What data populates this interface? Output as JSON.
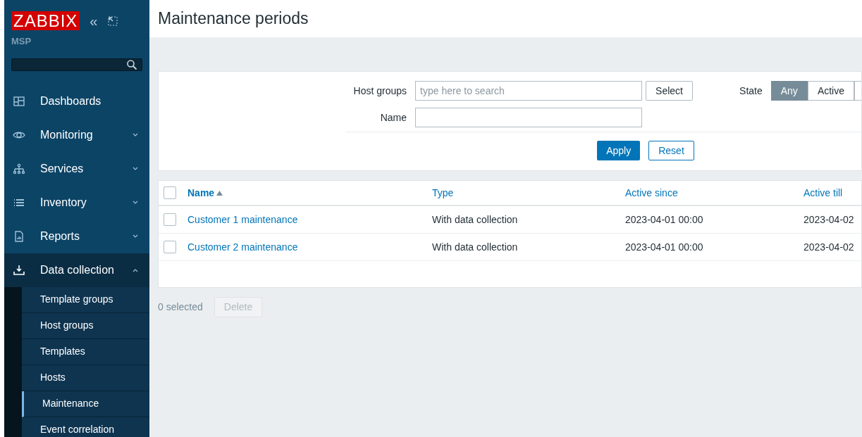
{
  "sidebar": {
    "logo": "ZABBIX",
    "collapse_glyph": "«",
    "server_name": "MSP",
    "menu": [
      {
        "label": "Dashboards",
        "kind": "dashboard",
        "expandable": false,
        "expanded": false
      },
      {
        "label": "Monitoring",
        "kind": "eye",
        "expandable": true,
        "expanded": false
      },
      {
        "label": "Services",
        "kind": "tree",
        "expandable": true,
        "expanded": false
      },
      {
        "label": "Inventory",
        "kind": "list",
        "expandable": true,
        "expanded": false
      },
      {
        "label": "Reports",
        "kind": "report",
        "expandable": true,
        "expanded": false
      },
      {
        "label": "Data collection",
        "kind": "download",
        "expandable": true,
        "expanded": true,
        "children": [
          {
            "label": "Template groups",
            "selected": false
          },
          {
            "label": "Host groups",
            "selected": false
          },
          {
            "label": "Templates",
            "selected": false
          },
          {
            "label": "Hosts",
            "selected": false
          },
          {
            "label": "Maintenance",
            "selected": true
          },
          {
            "label": "Event correlation",
            "selected": false
          }
        ]
      }
    ]
  },
  "page": {
    "title": "Maintenance periods"
  },
  "filter": {
    "host_groups_label": "Host groups",
    "host_groups_placeholder": "type here to search",
    "select_button": "Select",
    "name_label": "Name",
    "state_label": "State",
    "state_options": [
      {
        "label": "Any",
        "selected": true
      },
      {
        "label": "Active",
        "selected": false
      }
    ],
    "apply_button": "Apply",
    "reset_button": "Reset"
  },
  "table": {
    "all_checked": false,
    "columns": [
      {
        "label": "Name",
        "sorted": true
      },
      {
        "label": "Type",
        "sorted": false
      },
      {
        "label": "Active since",
        "sorted": false
      },
      {
        "label": "Active till",
        "sorted": false
      }
    ],
    "rows": [
      {
        "checked": false,
        "cells": [
          "Customer 1 maintenance",
          "With data collection",
          "2023-04-01 00:00",
          "2023-04-02"
        ]
      },
      {
        "checked": false,
        "cells": [
          "Customer 2 maintenance",
          "With data collection",
          "2023-04-01 00:00",
          "2023-04-02"
        ]
      }
    ]
  },
  "footer": {
    "selected_count": "0 selected",
    "delete_button": "Delete"
  }
}
